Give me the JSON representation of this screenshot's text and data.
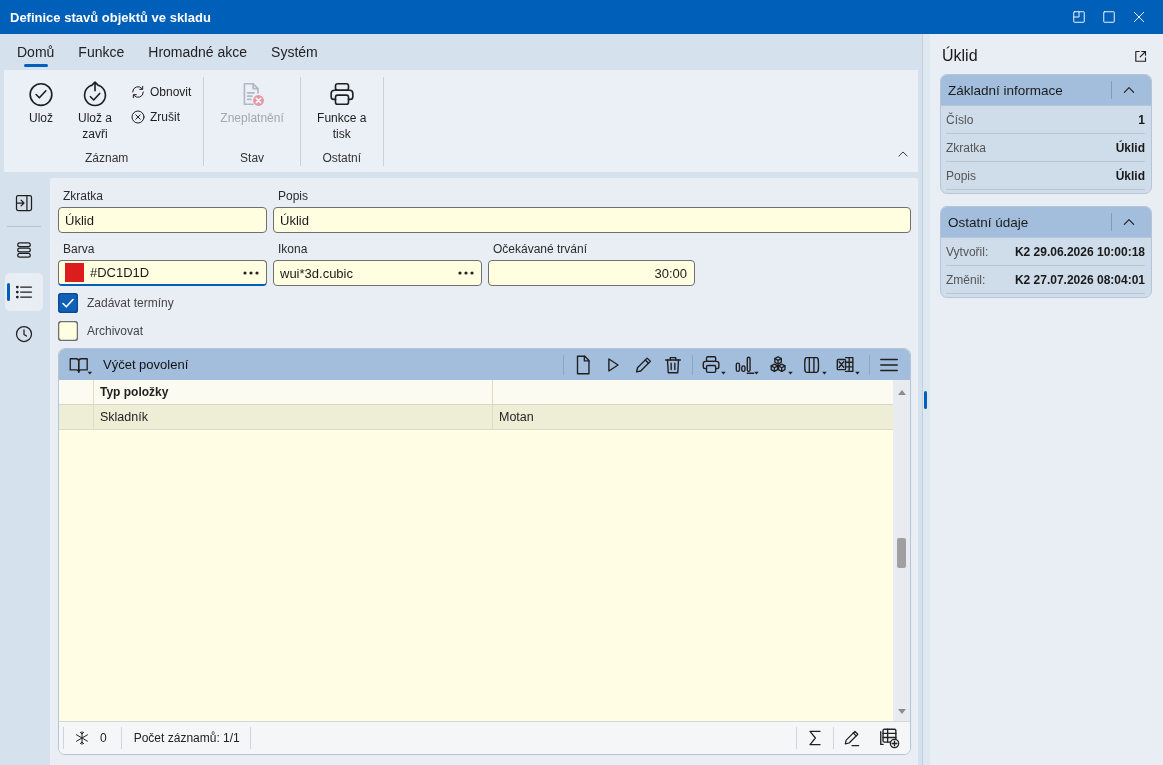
{
  "window": {
    "title": "Definice stavů objektů ve skladu"
  },
  "ribbon_tabs": [
    {
      "label": "Domů",
      "selected": true
    },
    {
      "label": "Funkce",
      "selected": false
    },
    {
      "label": "Hromadné akce",
      "selected": false
    },
    {
      "label": "Systém",
      "selected": false
    }
  ],
  "ribbon": {
    "groups": [
      {
        "label": "Záznam",
        "buttons": [
          {
            "label": "Ulož",
            "kind": "large",
            "disabled": false
          },
          {
            "label": "Ulož a zavři",
            "kind": "large",
            "disabled": false
          },
          {
            "label": "Obnovit",
            "kind": "small",
            "disabled": false
          },
          {
            "label": "Zrušit",
            "kind": "small",
            "disabled": false
          }
        ]
      },
      {
        "label": "Stav",
        "buttons": [
          {
            "label": "Zneplatnění",
            "kind": "large",
            "disabled": true
          }
        ]
      },
      {
        "label": "Ostatní",
        "buttons": [
          {
            "label": "Funkce a tisk",
            "kind": "large",
            "disabled": false
          }
        ]
      }
    ]
  },
  "sidebar": {
    "items": [
      {
        "selected": false
      },
      {
        "selected": false
      },
      {
        "selected": true
      },
      {
        "selected": false
      }
    ]
  },
  "form": {
    "fields": [
      {
        "label": "Zkratka",
        "value": "Úklid",
        "kind": "text",
        "focused": false
      },
      {
        "label": "Popis",
        "value": "Úklid",
        "kind": "text",
        "focused": false
      },
      {
        "label": "Barva",
        "value": "#DC1D1D",
        "kind": "picker",
        "color": "#dc1d1d",
        "focused": true
      },
      {
        "label": "Ikona",
        "value": "wui*3d.cubic",
        "kind": "picker",
        "focused": false
      },
      {
        "label": "Očekávané trvání",
        "value": "30:00",
        "kind": "number",
        "focused": false
      }
    ],
    "checkboxes": [
      {
        "label": "Zadávat termíny",
        "checked": true
      },
      {
        "label": "Archivovat",
        "checked": false
      }
    ]
  },
  "grid": {
    "title": "Výčet povolení",
    "columns": [
      "Typ položky"
    ],
    "rows": [
      {
        "selected": true,
        "cells": [
          "Skladník",
          "Motan"
        ]
      }
    ],
    "footer": {
      "counter": "0",
      "record_count": "Počet záznamů: 1/1"
    }
  },
  "detail_panel": {
    "title": "Úklid",
    "sections": [
      {
        "title": "Základní informace",
        "expanded": true,
        "rows": [
          {
            "label": "Číslo",
            "value": "1"
          },
          {
            "label": "Zkratka",
            "value": "Úklid"
          },
          {
            "label": "Popis",
            "value": "Úklid"
          }
        ]
      },
      {
        "title": "Ostatní údaje",
        "expanded": true,
        "rows": [
          {
            "label": "Vytvořil:",
            "value": "K2 29.06.2026 10:00:18"
          },
          {
            "label": "Změnil:",
            "value": "K2 27.07.2026 08:04:01"
          }
        ]
      }
    ]
  }
}
